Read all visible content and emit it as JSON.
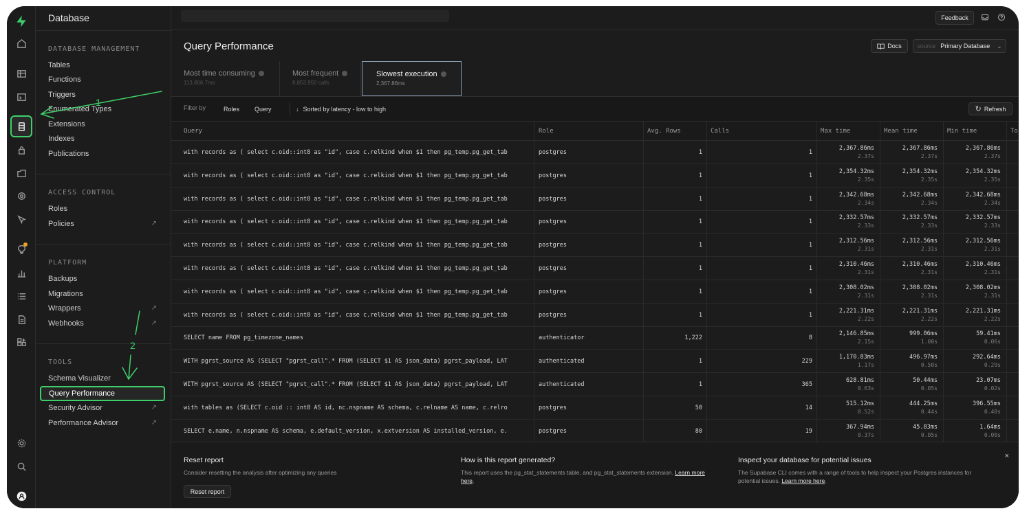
{
  "sidebar_title": "Database",
  "nav": {
    "sections": [
      {
        "key": "db",
        "title": "DATABASE MANAGEMENT",
        "items": [
          {
            "label": "Tables",
            "ext": ""
          },
          {
            "label": "Functions",
            "ext": ""
          },
          {
            "label": "Triggers",
            "ext": ""
          },
          {
            "label": "Enumerated Types",
            "ext": ""
          },
          {
            "label": "Extensions",
            "ext": ""
          },
          {
            "label": "Indexes",
            "ext": ""
          },
          {
            "label": "Publications",
            "ext": ""
          }
        ]
      },
      {
        "key": "ac",
        "title": "ACCESS CONTROL",
        "items": [
          {
            "label": "Roles",
            "ext": ""
          },
          {
            "label": "Policies",
            "ext": "↗"
          }
        ]
      },
      {
        "key": "pl",
        "title": "PLATFORM",
        "items": [
          {
            "label": "Backups",
            "ext": ""
          },
          {
            "label": "Migrations",
            "ext": ""
          },
          {
            "label": "Wrappers",
            "ext": "↗"
          },
          {
            "label": "Webhooks",
            "ext": "↗"
          }
        ]
      },
      {
        "key": "tl",
        "title": "TOOLS",
        "items": [
          {
            "label": "Schema Visualizer",
            "ext": ""
          },
          {
            "label": "Query Performance",
            "ext": "",
            "active": true
          },
          {
            "label": "Security Advisor",
            "ext": "↗"
          },
          {
            "label": "Performance Advisor",
            "ext": "↗"
          }
        ]
      }
    ]
  },
  "rail_icons": [
    "home-icon",
    "table-editor-icon",
    "sql-editor-icon",
    "database-icon",
    "auth-icon",
    "storage-icon",
    "edge-functions-icon",
    "realtime-icon",
    "advisors-icon",
    "reports-icon",
    "logs-icon",
    "api-docs-icon",
    "integrations-icon",
    "settings-icon",
    "search-icon",
    "user-avatar-icon"
  ],
  "topbar": {
    "feedback": "Feedback"
  },
  "page": {
    "title": "Query Performance",
    "docs": "Docs",
    "source_label": "source",
    "source_value": "Primary Database"
  },
  "tabs": [
    {
      "label": "Most time consuming",
      "sub": "113,806.7ms"
    },
    {
      "label": "Most frequent",
      "sub": "8,853,950 calls"
    },
    {
      "label": "Slowest execution",
      "sub": "2,367.86ms"
    }
  ],
  "filter": {
    "label": "Filter by",
    "roles": "Roles",
    "query": "Query",
    "sort": "Sorted by latency - low to high",
    "refresh": "Refresh"
  },
  "table": {
    "columns": [
      "Query",
      "Role",
      "Avg. Rows",
      "Calls",
      "Max time",
      "Mean time",
      "Min time",
      "To"
    ],
    "rows": [
      {
        "query": "with records as ( select c.oid::int8 as \"id\", case c.relkind when $1 then pg_temp.pg_get_tab",
        "role": "postgres",
        "rows": "1",
        "calls": "1",
        "max": "2,367.86ms",
        "max_s": "2.37s",
        "mean": "2,367.86ms",
        "mean_s": "2.37s",
        "min": "2,367.86ms",
        "min_s": "2.37s"
      },
      {
        "query": "with records as ( select c.oid::int8 as \"id\", case c.relkind when $1 then pg_temp.pg_get_tab",
        "role": "postgres",
        "rows": "1",
        "calls": "1",
        "max": "2,354.32ms",
        "max_s": "2.35s",
        "mean": "2,354.32ms",
        "mean_s": "2.35s",
        "min": "2,354.32ms",
        "min_s": "2.35s"
      },
      {
        "query": "with records as ( select c.oid::int8 as \"id\", case c.relkind when $1 then pg_temp.pg_get_tab",
        "role": "postgres",
        "rows": "1",
        "calls": "1",
        "max": "2,342.68ms",
        "max_s": "2.34s",
        "mean": "2,342.68ms",
        "mean_s": "2.34s",
        "min": "2,342.68ms",
        "min_s": "2.34s"
      },
      {
        "query": "with records as ( select c.oid::int8 as \"id\", case c.relkind when $1 then pg_temp.pg_get_tab",
        "role": "postgres",
        "rows": "1",
        "calls": "1",
        "max": "2,332.57ms",
        "max_s": "2.33s",
        "mean": "2,332.57ms",
        "mean_s": "2.33s",
        "min": "2,332.57ms",
        "min_s": "2.33s"
      },
      {
        "query": "with records as ( select c.oid::int8 as \"id\", case c.relkind when $1 then pg_temp.pg_get_tab",
        "role": "postgres",
        "rows": "1",
        "calls": "1",
        "max": "2,312.56ms",
        "max_s": "2.31s",
        "mean": "2,312.56ms",
        "mean_s": "2.31s",
        "min": "2,312.56ms",
        "min_s": "2.31s"
      },
      {
        "query": "with records as ( select c.oid::int8 as \"id\", case c.relkind when $1 then pg_temp.pg_get_tab",
        "role": "postgres",
        "rows": "1",
        "calls": "1",
        "max": "2,310.46ms",
        "max_s": "2.31s",
        "mean": "2,310.46ms",
        "mean_s": "2.31s",
        "min": "2,310.46ms",
        "min_s": "2.31s"
      },
      {
        "query": "with records as ( select c.oid::int8 as \"id\", case c.relkind when $1 then pg_temp.pg_get_tab",
        "role": "postgres",
        "rows": "1",
        "calls": "1",
        "max": "2,308.02ms",
        "max_s": "2.31s",
        "mean": "2,308.02ms",
        "mean_s": "2.31s",
        "min": "2,308.02ms",
        "min_s": "2.31s"
      },
      {
        "query": "with records as ( select c.oid::int8 as \"id\", case c.relkind when $1 then pg_temp.pg_get_tab",
        "role": "postgres",
        "rows": "1",
        "calls": "1",
        "max": "2,221.31ms",
        "max_s": "2.22s",
        "mean": "2,221.31ms",
        "mean_s": "2.22s",
        "min": "2,221.31ms",
        "min_s": "2.22s"
      },
      {
        "query": "SELECT name FROM pg_timezone_names",
        "role": "authenticator",
        "rows": "1,222",
        "calls": "8",
        "max": "2,146.85ms",
        "max_s": "2.15s",
        "mean": "999.06ms",
        "mean_s": "1.00s",
        "min": "59.41ms",
        "min_s": "0.06s"
      },
      {
        "query": "WITH pgrst_source AS (SELECT \"pgrst_call\".* FROM (SELECT $1 AS json_data) pgrst_payload, LAT",
        "role": "authenticated",
        "rows": "1",
        "calls": "229",
        "max": "1,170.83ms",
        "max_s": "1.17s",
        "mean": "496.97ms",
        "mean_s": "0.50s",
        "min": "292.64ms",
        "min_s": "0.29s"
      },
      {
        "query": "WITH pgrst_source AS (SELECT \"pgrst_call\".* FROM (SELECT $1 AS json_data) pgrst_payload, LAT",
        "role": "authenticated",
        "rows": "1",
        "calls": "365",
        "max": "628.81ms",
        "max_s": "0.63s",
        "mean": "50.44ms",
        "mean_s": "0.05s",
        "min": "23.07ms",
        "min_s": "0.02s"
      },
      {
        "query": "with tables as (SELECT c.oid :: int8 AS id, nc.nspname AS schema, c.relname AS name, c.relro",
        "role": "postgres",
        "rows": "50",
        "calls": "14",
        "max": "515.12ms",
        "max_s": "0.52s",
        "mean": "444.25ms",
        "mean_s": "0.44s",
        "min": "396.55ms",
        "min_s": "0.40s"
      },
      {
        "query": "SELECT e.name, n.nspname AS schema, e.default_version, x.extversion AS installed_version, e.",
        "role": "postgres",
        "rows": "80",
        "calls": "19",
        "max": "367.94ms",
        "max_s": "0.37s",
        "mean": "45.83ms",
        "mean_s": "0.05s",
        "min": "1.64ms",
        "min_s": "0.00s"
      }
    ]
  },
  "bottom": {
    "reset": {
      "title": "Reset report",
      "desc": "Consider resetting the analysis after optimizing any queries",
      "button": "Reset report"
    },
    "how": {
      "title": "How is this report generated?",
      "desc": "This report uses the pg_stat_statements table, and pg_stat_statements extension.",
      "link": "Learn more here",
      "tail": "."
    },
    "inspect": {
      "title": "Inspect your database for potential issues",
      "desc": "The Supabase CLI comes with a range of tools to help inspect your Postgres instances for potential issues.",
      "link": "Learn more here",
      "tail": "."
    },
    "close": "×"
  },
  "annotations": {
    "one": "1",
    "two": "2",
    "color": "#3fcf6a"
  }
}
